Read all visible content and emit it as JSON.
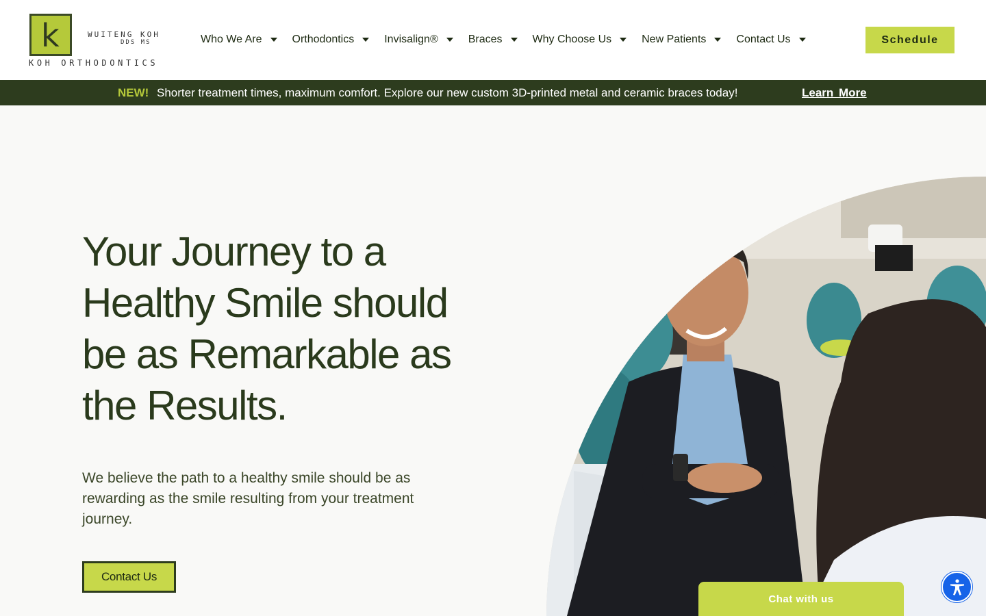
{
  "header": {
    "logo": {
      "mark": "k",
      "doctor_name": "WUITENG KOH",
      "credentials": "DDS MS",
      "practice_name": "KOH ORTHODONTICS"
    },
    "nav": [
      {
        "label": "Who We Are",
        "has_dropdown": true
      },
      {
        "label": "Orthodontics",
        "has_dropdown": true
      },
      {
        "label": "Invisalign®",
        "has_dropdown": true
      },
      {
        "label": "Braces",
        "has_dropdown": true
      },
      {
        "label": "Why Choose Us",
        "has_dropdown": true
      },
      {
        "label": "New Patients",
        "has_dropdown": true
      },
      {
        "label": "Contact Us",
        "has_dropdown": true
      }
    ],
    "schedule_label": "Schedule"
  },
  "announcement": {
    "badge": "NEW!",
    "text": "Shorter treatment times, maximum comfort. Explore our new custom 3D-printed metal and ceramic braces today!",
    "link_label": "Learn More"
  },
  "hero": {
    "title": "Your Journey to a Healthy Smile should be as Remarkable as the Results.",
    "body": "We believe the path to a healthy smile should be as rewarding as the smile resulting from your treatment journey.",
    "cta_label": "Contact Us"
  },
  "chat": {
    "label": "Chat with us"
  },
  "colors": {
    "accent": "#c7d84a",
    "dark_green": "#2d3c1e",
    "accessibility_blue": "#1663e8"
  }
}
